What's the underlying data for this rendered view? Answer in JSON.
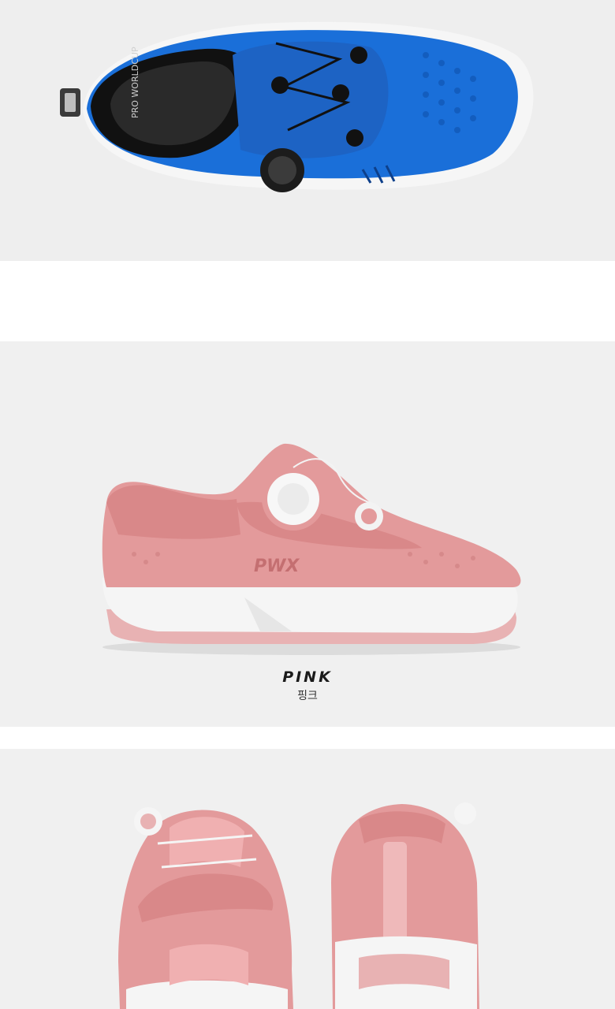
{
  "color_caption": {
    "name_en": "PINK",
    "name_ko": "핑크"
  },
  "brand": {
    "mark": "PWX",
    "insole_text": "PRO WORLDCUP"
  },
  "colors": {
    "blue_shoe": "#1a6fd9",
    "pink_shoe": "#e39a9b",
    "sole": "#f4f4f4",
    "background": "#efefef"
  }
}
